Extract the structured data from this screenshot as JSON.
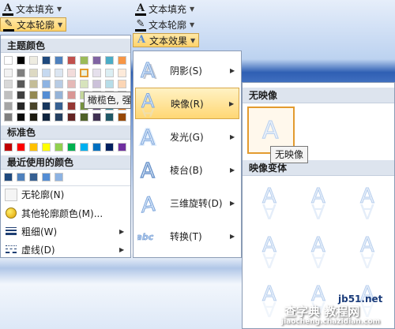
{
  "ribbon": {
    "text_fill": "文本填充",
    "text_outline": "文本轮廓",
    "text_effects": "文本效果"
  },
  "color_menu": {
    "theme_colors": "主题颜色",
    "standard_colors": "标准色",
    "recent_colors": "最近使用的颜色",
    "no_outline": "无轮廓(N)",
    "more_colors": "其他轮廓颜色(M)...",
    "weight": "粗细(W)",
    "dashes": "虚线(D)",
    "tooltip": "橄榄色, 强",
    "theme_top_row": [
      "#ffffff",
      "#000000",
      "#eeece1",
      "#1f497d",
      "#4f81bd",
      "#c0504d",
      "#9bbb59",
      "#8064a2",
      "#4bacc6",
      "#f79646"
    ],
    "theme_shades": [
      [
        "#f2f2f2",
        "#7f7f7f",
        "#ddd9c3",
        "#c6d9f0",
        "#dbe5f1",
        "#f2dcdb",
        "#ebf1dd",
        "#e5e0ec",
        "#dbeef3",
        "#fdeada"
      ],
      [
        "#d8d8d8",
        "#595959",
        "#c4bd97",
        "#8db3e2",
        "#b8cce4",
        "#e5b9b7",
        "#d7e3bc",
        "#ccc1d9",
        "#b7dde8",
        "#fbd5b5"
      ],
      [
        "#bfbfbf",
        "#3f3f3f",
        "#938953",
        "#548dd4",
        "#95b3d7",
        "#d99694",
        "#c3d69b",
        "#b2a2c7",
        "#92cddc",
        "#fac08f"
      ],
      [
        "#a5a5a5",
        "#262626",
        "#494429",
        "#17365d",
        "#366092",
        "#953734",
        "#76923c",
        "#5f497a",
        "#31859b",
        "#e36c09"
      ],
      [
        "#7f7f7f",
        "#0c0c0c",
        "#1d1b10",
        "#0f243e",
        "#244061",
        "#632423",
        "#4f6128",
        "#3f3151",
        "#205867",
        "#974806"
      ]
    ],
    "standard": [
      "#c00000",
      "#ff0000",
      "#ffc000",
      "#ffff00",
      "#92d050",
      "#00b050",
      "#00b0f0",
      "#0070c0",
      "#002060",
      "#7030a0"
    ],
    "recent": [
      "#1f497d",
      "#4f81bd",
      "#366092",
      "#548dd4",
      "#8db3e2"
    ]
  },
  "effects_menu": {
    "items": [
      {
        "label": "阴影(S)",
        "icon": "shadow-a-icon"
      },
      {
        "label": "映像(R)",
        "icon": "reflection-a-icon"
      },
      {
        "label": "发光(G)",
        "icon": "glow-a-icon"
      },
      {
        "label": "棱台(B)",
        "icon": "bevel-a-icon"
      },
      {
        "label": "三维旋转(D)",
        "icon": "3d-rotation-a-icon"
      },
      {
        "label": "转换(T)",
        "icon": "transform-abc-icon"
      }
    ]
  },
  "reflection_panel": {
    "no_reflection_header": "无映像",
    "variants_header": "映像变体",
    "tooltip": "无映像"
  },
  "watermark": {
    "line1": "查字典 教程网",
    "line2": "jiaocheng.chazidian.com",
    "site": "jb51.net"
  },
  "colors": {
    "accent_hover": "#ffd774",
    "menu_border": "#8a9bb5",
    "header_bg": "#dde4ee"
  }
}
